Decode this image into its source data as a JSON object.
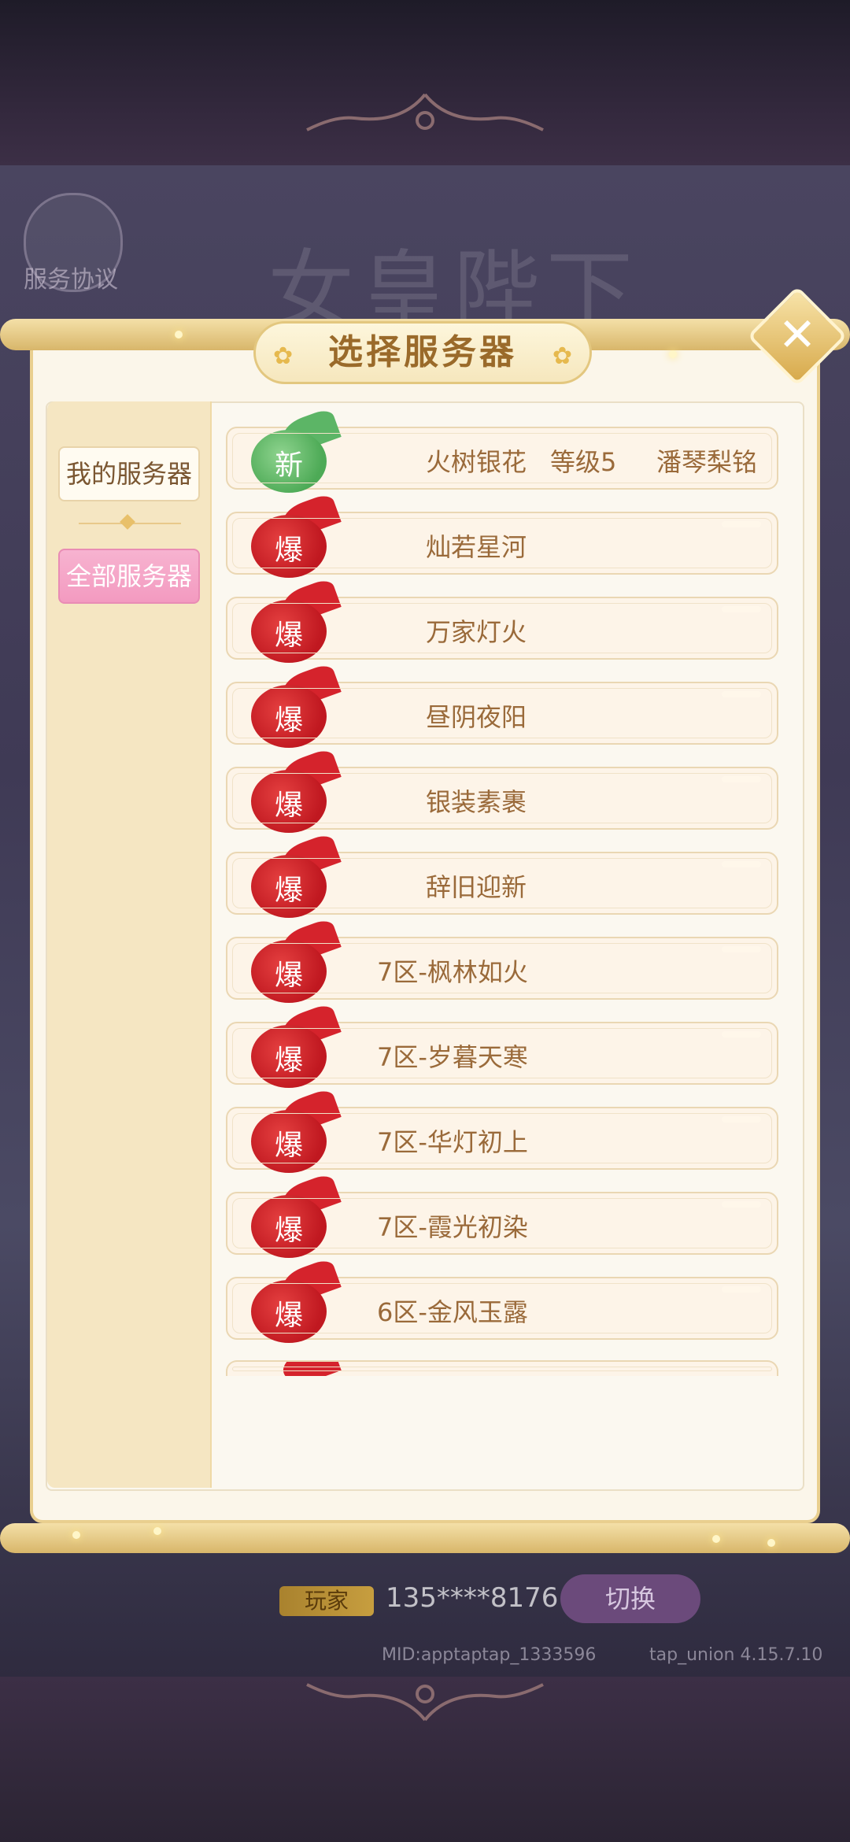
{
  "dialog": {
    "title": "选择服务器",
    "title_flower": "✿",
    "close_glyph": "✕"
  },
  "sidebar": {
    "mine_label": "我的服务器",
    "all_label": "全部服务器"
  },
  "servers": [
    {
      "badge": "新",
      "type": "new",
      "name": "火树银花",
      "level": "等级5",
      "player": "潘琴梨铭"
    },
    {
      "badge": "爆",
      "type": "hot",
      "name": "灿若星河"
    },
    {
      "badge": "爆",
      "type": "hot",
      "name": "万家灯火"
    },
    {
      "badge": "爆",
      "type": "hot",
      "name": "昼阴夜阳"
    },
    {
      "badge": "爆",
      "type": "hot",
      "name": "银装素裹"
    },
    {
      "badge": "爆",
      "type": "hot",
      "name": "辞旧迎新"
    },
    {
      "badge": "爆",
      "type": "hot",
      "name": "7区-枫林如火"
    },
    {
      "badge": "爆",
      "type": "hot",
      "name": "7区-岁暮天寒"
    },
    {
      "badge": "爆",
      "type": "hot",
      "name": "7区-华灯初上"
    },
    {
      "badge": "爆",
      "type": "hot",
      "name": "7区-霞光初染"
    },
    {
      "badge": "爆",
      "type": "hot",
      "name": "6区-金风玉露"
    }
  ],
  "background": {
    "left_label": "服务协议",
    "title_watermark": "女皇陛下"
  },
  "account": {
    "label": "玩家",
    "number": "135****8176",
    "switch_label": "切换",
    "mid": "MID:apptaptap_1333596",
    "version": "tap_union 4.15.7.10"
  },
  "colors": {
    "accent_gold": "#d8b66a",
    "hot_badge": "#c01820",
    "new_badge": "#4daa56",
    "all_button": "#f39ac0",
    "text_brown": "#9a6a3a"
  }
}
